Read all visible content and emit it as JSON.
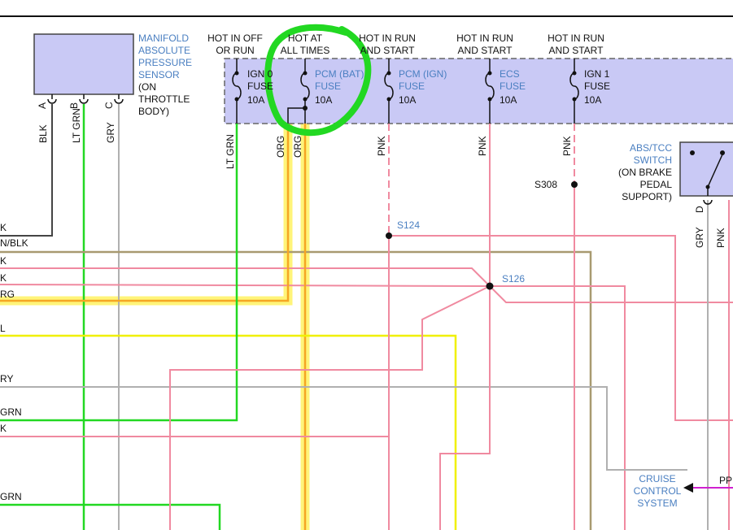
{
  "colors": {
    "box_fill": "#c9c9f5",
    "label_blue": "#4a7fc1",
    "wire_ltgrn": "#22d822",
    "wire_gry": "#b0b0b0",
    "wire_blk": "#444444",
    "wire_pnk": "#f08aa0",
    "wire_yel": "#f0f000",
    "wire_tan": "#a89a70",
    "wire_org": "#f5a623",
    "highlight_yellow": "#fff36a",
    "circle_green": "#22d822",
    "wire_ppl": "#d020d0"
  },
  "map_sensor": {
    "title": [
      "MANIFOLD",
      "ABSOLUTE",
      "PRESSURE",
      "SENSOR"
    ],
    "sub": [
      "(ON",
      "THROTTLE",
      "BODY)"
    ],
    "pins": [
      "A",
      "B",
      "C"
    ],
    "pin_wires": [
      "BLK",
      "LT GRN",
      "GRY"
    ]
  },
  "fuse_headers": [
    [
      "HOT IN OFF",
      "OR RUN"
    ],
    [
      "HOT AT",
      "ALL TIMES"
    ],
    [
      "HOT IN RUN",
      "AND START"
    ],
    [
      "HOT IN RUN",
      "AND START"
    ],
    [
      "HOT IN RUN",
      "AND START"
    ]
  ],
  "fuses": [
    {
      "name": [
        "IGN 0",
        "FUSE"
      ],
      "rating": "10A",
      "blue": false
    },
    {
      "name": [
        "PCM (BAT)",
        "FUSE"
      ],
      "rating": "10A",
      "blue": true
    },
    {
      "name": [
        "PCM (IGN)",
        "FUSE"
      ],
      "rating": "10A",
      "blue": true
    },
    {
      "name": [
        "ECS",
        "FUSE"
      ],
      "rating": "10A",
      "blue": true
    },
    {
      "name": [
        "IGN 1",
        "FUSE"
      ],
      "rating": "10A",
      "blue": false
    }
  ],
  "fuse_wires": [
    "LT GRN",
    "ORG",
    "ORG",
    "PNK",
    "PNK",
    "PNK"
  ],
  "splices": [
    "S124",
    "S126",
    "S308"
  ],
  "left_wire_labels": [
    "K",
    "N/BLK",
    "K",
    "K",
    "RG",
    "L",
    "RY",
    "GRN",
    "K",
    "GRN"
  ],
  "abs_switch": {
    "title": [
      "ABS/TCC",
      "SWITCH"
    ],
    "sub": [
      "(ON BRAKE",
      "PEDAL",
      "SUPPORT)"
    ],
    "pin": "D",
    "wires": [
      "GRY",
      "PNK"
    ]
  },
  "cruise": {
    "title": [
      "CRUISE",
      "CONTROL",
      "SYSTEM"
    ],
    "wire": "PP"
  }
}
